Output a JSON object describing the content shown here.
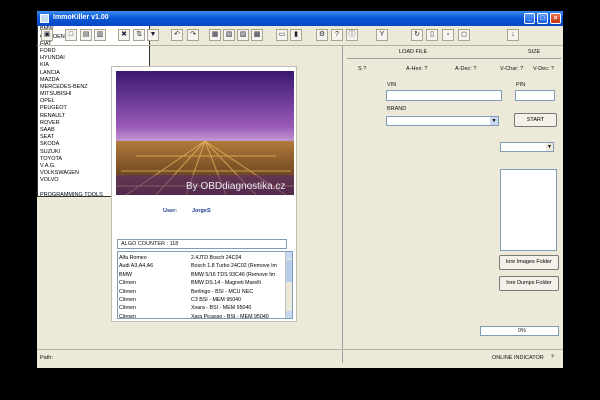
{
  "window": {
    "title": "ImmoKiller v1.00"
  },
  "toolbar": {
    "icons": [
      "chip-icon",
      "new-file-icon",
      "open-file-icon",
      "save-icon",
      "erase-icon",
      "swap-icon",
      "filter-icon",
      "undo-icon",
      "redo-icon",
      "copy-icon",
      "compare-icon",
      "view-icon",
      "print-icon",
      "calc-icon",
      "checksum-icon",
      "settings-icon",
      "help-icon",
      "info-icon",
      "tools-icon",
      "refresh-icon",
      "hex-icon",
      "folder-icon",
      "select-icon",
      "exit-icon"
    ]
  },
  "banner": {
    "watermark": "By OBDdiagnostika.cz"
  },
  "user": {
    "label": "User:",
    "name": "JorgeS"
  },
  "algo": {
    "counter": "ALGO COUNTER : 118"
  },
  "algo_list": [
    [
      "Alfa Romeo",
      "2.4JTD Bosch 24C04"
    ],
    [
      "Audi A3,A4,A6",
      "Bosch 1.8 Turbo 24C02 (Remove Im"
    ],
    [
      "BMW",
      "BMW 5/16 TDS 93C46 (Remove Im"
    ],
    [
      "Citroen",
      "BMW DS.14 - Magneti Marelli"
    ],
    [
      "Citroen",
      "Berlingo - BSI - MCU NEC"
    ],
    [
      "Citroen",
      "C3 BSI - MEM 95040"
    ],
    [
      "Citroen",
      "Xsara - BSI - MEM 95040"
    ],
    [
      "Citroen",
      "Xara Picasso   - BSI - MEM 95040"
    ],
    [
      "Citroen",
      "EDC15 SP08C3 (Remove Immo)"
    ]
  ],
  "file": {
    "load_label": "LOAD FILE",
    "size_label": "SIZE",
    "s_label": "S ?",
    "ahex_label": "A-Hex: ?",
    "adec_label": "A-Dec: ?",
    "vchar_label": "V-Char: ?",
    "vdec_label": "V-Dec: ?"
  },
  "vin": {
    "label": "VIN",
    "value": ""
  },
  "pin": {
    "label": "PIN",
    "value": ""
  },
  "brand": {
    "label": "BRAND",
    "selected": "",
    "options": [
      "ALFA ROMEO",
      "AUDI",
      "BMW",
      "CITROEN",
      "FIAT",
      "FORD",
      "HYUNDAI",
      "KIA",
      "LANCIA",
      "MAZDA",
      "MERCEDES-BENZ",
      "MITSUBISHI",
      "OPEL",
      "PEUGEOT",
      "RENAULT",
      "ROVER",
      "SAAB",
      "SEAT",
      "SKODA",
      "SUZUKI",
      "TOYOTA",
      "V.A.G.",
      "VOLKSWAGEN",
      "VOLVO",
      "",
      "PROGRAMMING TOOLS"
    ]
  },
  "buttons": {
    "start": "START",
    "images_folder": "lore Images Folder",
    "dumps_folder": "lore Dumps Folder"
  },
  "progress": {
    "text": "0%",
    "value": 0
  },
  "status": {
    "path_label": "Path:",
    "online": "ONLINE INDICATOR"
  },
  "colors": {
    "titlebar": "#0a58d8",
    "window_bg": "#ece9d8",
    "field_border": "#7f9db9"
  }
}
